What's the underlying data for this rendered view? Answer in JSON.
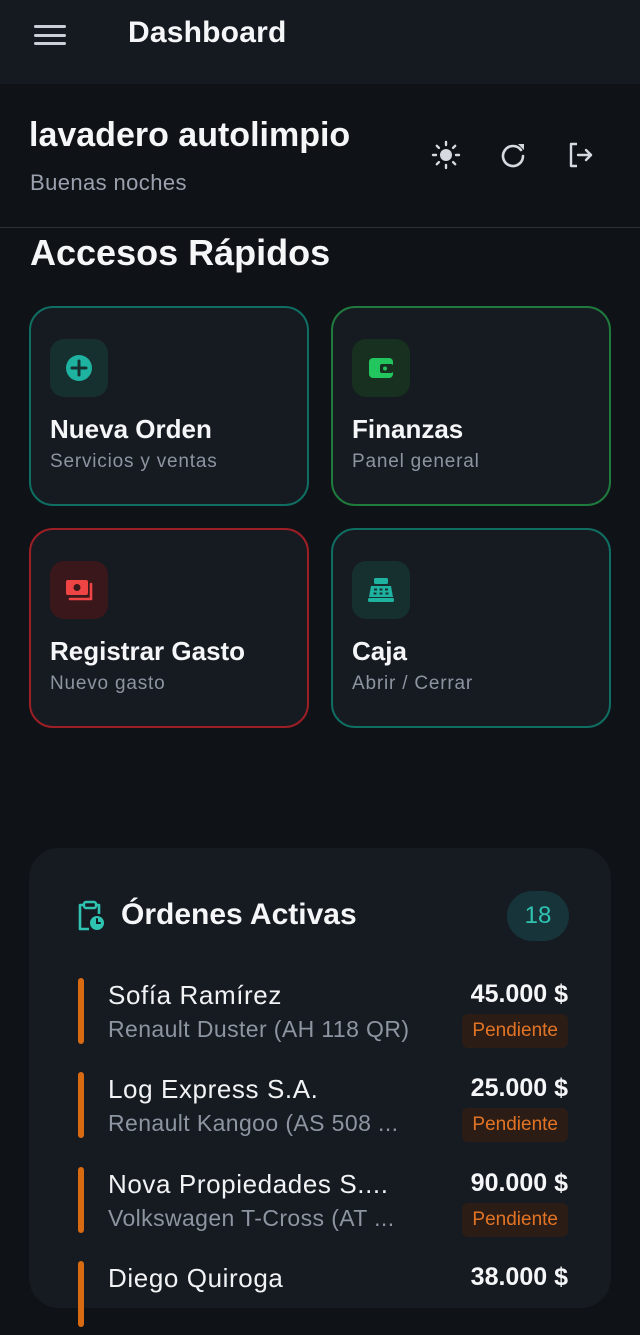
{
  "topbar": {
    "title": "Dashboard",
    "menu_icon": "hamburger-menu-icon"
  },
  "header": {
    "org_name": "lavadero autolimpio",
    "greeting": "Buenas noches",
    "icons": [
      "sun-icon",
      "refresh-icon",
      "logout-icon"
    ]
  },
  "quick_access": {
    "title": "Accesos Rápidos",
    "cards": [
      {
        "title": "Nueva Orden",
        "subtitle": "Servicios y ventas",
        "icon": "plus-circle-icon",
        "color": "#0f6d62"
      },
      {
        "title": "Finanzas",
        "subtitle": "Panel general",
        "icon": "wallet-icon",
        "color": "#1f7a3d"
      },
      {
        "title": "Registrar Gasto",
        "subtitle": "Nuevo gasto",
        "icon": "money-icon",
        "color": "#9b1f25"
      },
      {
        "title": "Caja",
        "subtitle": "Abrir / Cerrar",
        "icon": "cash-register-icon",
        "color": "#0f6d62"
      }
    ]
  },
  "active_orders": {
    "title": "Órdenes Activas",
    "count": "18",
    "icon": "clipboard-clock-icon",
    "items": [
      {
        "name": "Sofía Ramírez",
        "vehicle": "Renault Duster (AH 118 QR)",
        "price": "45.000 $",
        "status": "Pendiente"
      },
      {
        "name": "Log Express S.A.",
        "vehicle": "Renault Kangoo (AS 508 ...",
        "price": "25.000 $",
        "status": "Pendiente"
      },
      {
        "name": "Nova Propiedades S....",
        "vehicle": "Volkswagen T-Cross (AT ...",
        "price": "90.000 $",
        "status": "Pendiente"
      },
      {
        "name": "Diego Quiroga",
        "vehicle": "",
        "price": "38.000 $",
        "status": ""
      }
    ]
  },
  "colors": {
    "background": "#0f1217",
    "card": "#161a21",
    "accent_teal": "#2fc4b2",
    "accent_green": "#22c55e",
    "accent_red": "#ef4444",
    "pending_orange": "#e27324"
  }
}
